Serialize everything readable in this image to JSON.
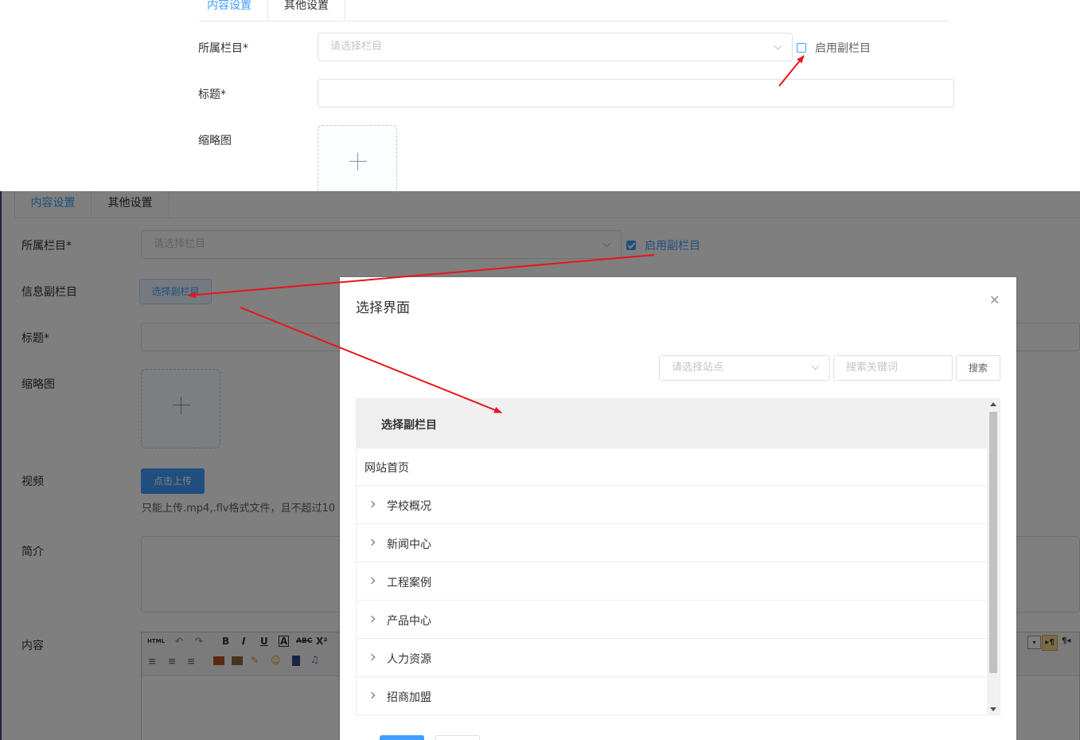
{
  "top": {
    "tabs": [
      "内容设置",
      "其他设置"
    ],
    "column_label": "所属栏目*",
    "column_placeholder": "请选择栏目",
    "sub_column_checkbox_label": "启用副栏目",
    "title_label": "标题*",
    "thumbnail_label": "缩略图"
  },
  "bottom": {
    "tabs": [
      "内容设置",
      "其他设置"
    ],
    "column_label": "所属栏目*",
    "column_placeholder": "请选择栏目",
    "sub_column_checkbox_label": "启用副栏目",
    "info_sub_column_label": "信息副栏目",
    "select_sub_column_button": "选择副栏目",
    "title_label": "标题*",
    "thumbnail_label": "缩略图",
    "video_label": "视频",
    "upload_button": "点击上传",
    "upload_hint": "只能上传.mp4,.flv格式文件，且不超过10",
    "summary_label": "简介",
    "content_label": "内容",
    "editor_html_label": "HTML"
  },
  "dialog": {
    "title": "选择界面",
    "site_placeholder": "请选择站点",
    "keyword_placeholder": "搜索关键词",
    "search_button": "搜索",
    "table_header": "选择副栏目",
    "rows": [
      {
        "label": "网站首页",
        "expandable": false
      },
      {
        "label": "学校概况",
        "expandable": true
      },
      {
        "label": "新闻中心",
        "expandable": true
      },
      {
        "label": "工程案例",
        "expandable": true
      },
      {
        "label": "产品中心",
        "expandable": true
      },
      {
        "label": "人力资源",
        "expandable": true
      },
      {
        "label": "招商加盟",
        "expandable": true
      }
    ]
  },
  "colors": {
    "accent": "#409eff",
    "annotation_arrow": "#e8141c"
  }
}
